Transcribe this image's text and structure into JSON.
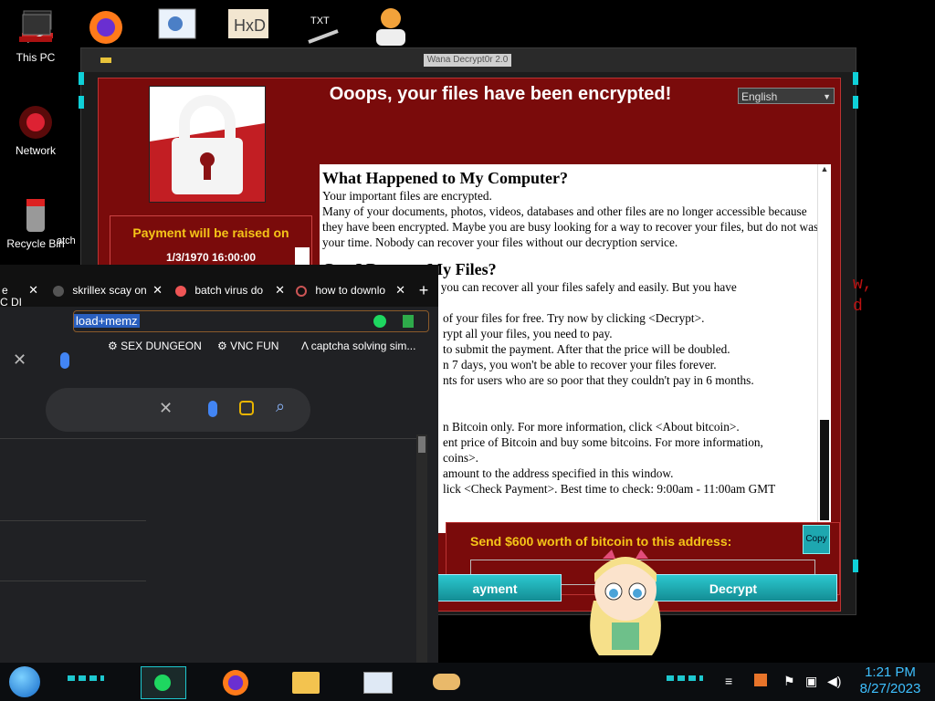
{
  "desktop": {
    "icons": [
      {
        "label": "This PC"
      },
      {
        "label": "Network"
      },
      {
        "label": "Recycle Bin"
      }
    ],
    "partial_label": "atch"
  },
  "wannacry": {
    "window_title": "Wana Decrypt0r 2.0",
    "heading": "Ooops, your files have been encrypted!",
    "language": "English",
    "payment_raised_title": "Payment will be raised on",
    "payment_raised_date": "1/3/1970 16:00:00",
    "body": {
      "h1": "What Happened to My Computer?",
      "p1a": "Your important files are encrypted.",
      "p1b": "Many of your documents, photos, videos, databases and other files are no longer accessible because they have been encrypted. Maybe you are busy looking for a way to recover your files, but do not waste your time. Nobody can recover your files without our decryption service.",
      "h2": "Can I Recover My Files?",
      "p2a": "Sure. We guarantee that you can recover all your files safely and easily. But you have",
      "p2b": "of your files for free. Try now by clicking <Decrypt>.",
      "p2c": "rypt all your files, you need to pay.",
      "p2d": "to submit the payment. After that the price will be doubled.",
      "p2e": "n 7 days, you won't be able to recover your files forever.",
      "p2f": "nts for users who are so poor that they couldn't pay in 6 months.",
      "p3a": "n Bitcoin only. For more information, click <About bitcoin>.",
      "p3b": "ent price of Bitcoin and buy some bitcoins. For more information,",
      "p3c": "coins>.",
      "p3d": "amount to the address specified in this window.",
      "p3e": "lick <Check Payment>. Best time to check: 9:00am - 11:00am GMT"
    },
    "send_label": "Send $600 worth of bitcoin to this address:",
    "copy_label": "Copy",
    "check_payment_label": "ayment",
    "decrypt_label": "Decrypt"
  },
  "browser": {
    "tabs": [
      {
        "label": "e"
      },
      {
        "label": "skrillex scay on"
      },
      {
        "label": "batch virus do"
      },
      {
        "label": "how to downlo"
      }
    ],
    "new_tab": "+",
    "url": "load+memz",
    "bookmarks": [
      {
        "label": "SEX DUNGEON"
      },
      {
        "label": "VNC FUN"
      },
      {
        "label": "captcha solving sim..."
      }
    ],
    "left_partial": "C DI"
  },
  "background_text": [
    "w,",
    "d"
  ],
  "taskbar": {
    "time": "1:21 PM",
    "date": "8/27/2023"
  },
  "colors": {
    "wannacry_red": "#7a0b0b",
    "accent_cyan": "#1ec8cf",
    "payment_yellow": "#f5c518",
    "clock_blue": "#3ec0ff"
  }
}
